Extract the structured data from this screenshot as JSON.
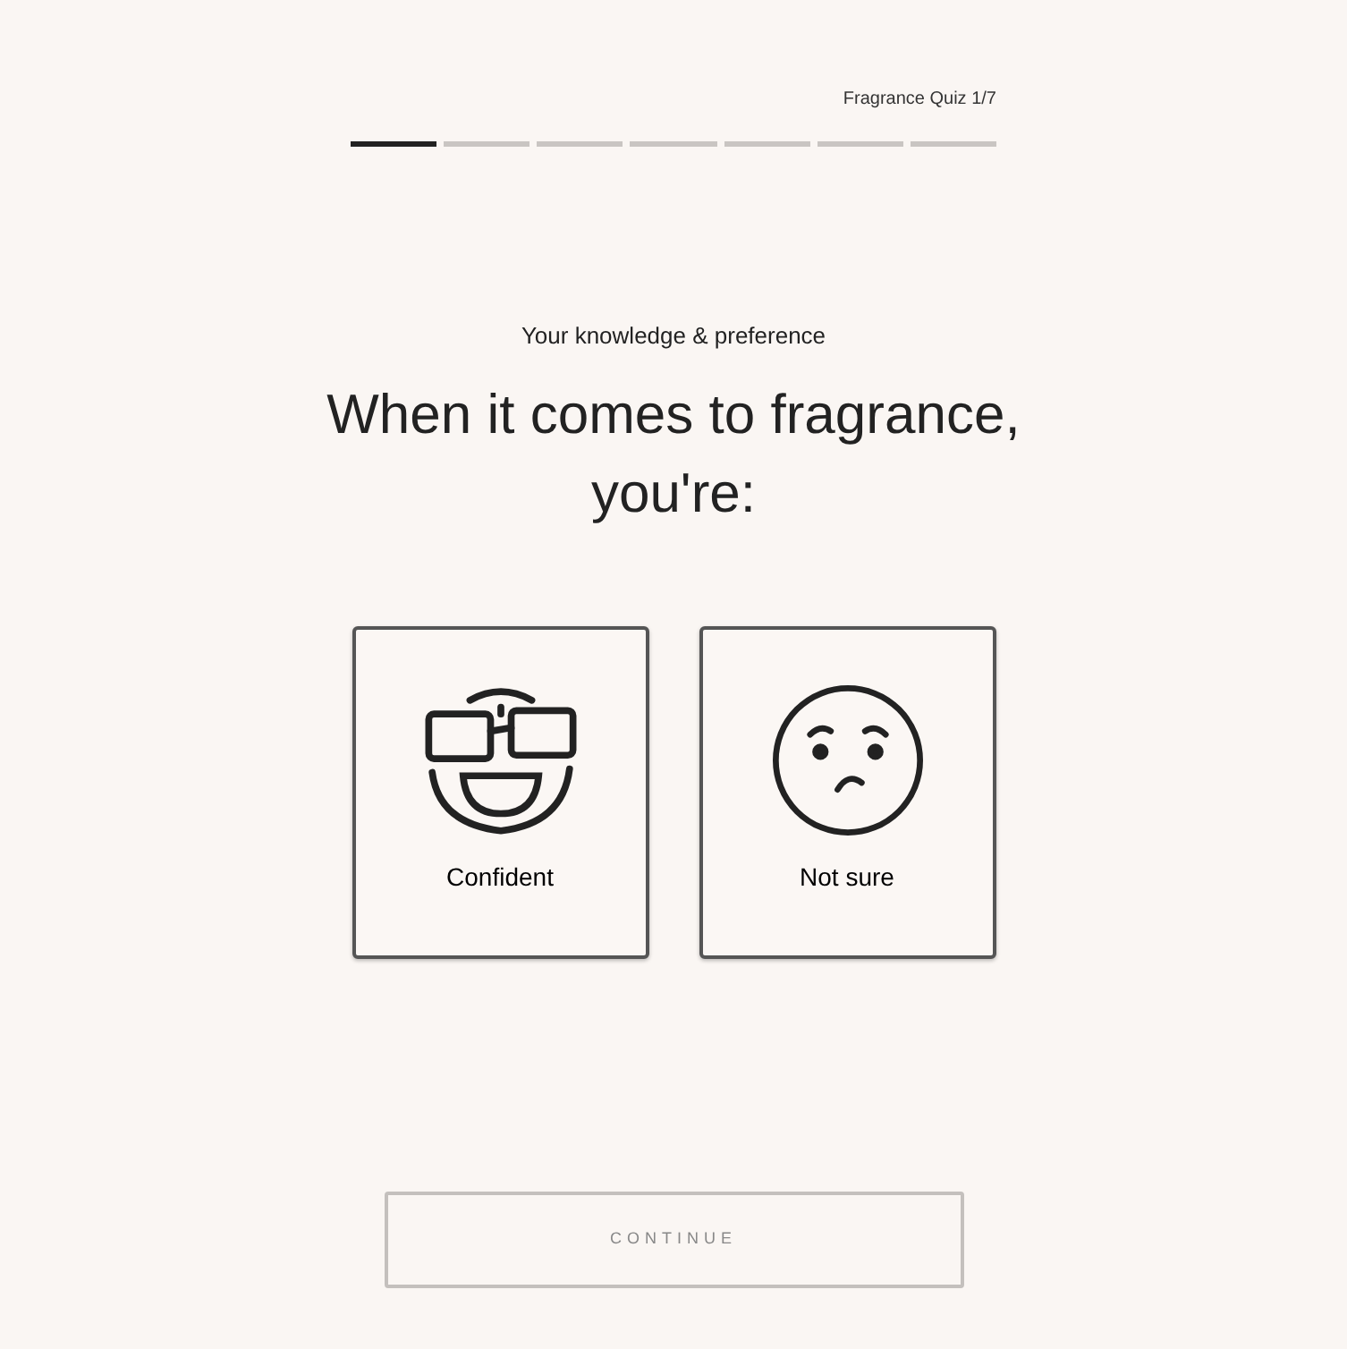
{
  "quiz_label": "Fragrance Quiz 1/7",
  "progress": [
    {
      "done": true
    },
    {
      "done": false
    },
    {
      "done": false
    },
    {
      "done": false
    },
    {
      "done": false
    },
    {
      "done": false
    },
    {
      "done": false
    }
  ],
  "subtitle": "Your knowledge & preference",
  "question": "When it comes to fragrance, you're:",
  "options": [
    {
      "kind": "confident",
      "label": "Confident",
      "selected": false
    },
    {
      "kind": "unsure",
      "label": "Not sure",
      "selected": false
    }
  ],
  "continue_button": {
    "label": "CONTINUE",
    "disabled": true
  }
}
